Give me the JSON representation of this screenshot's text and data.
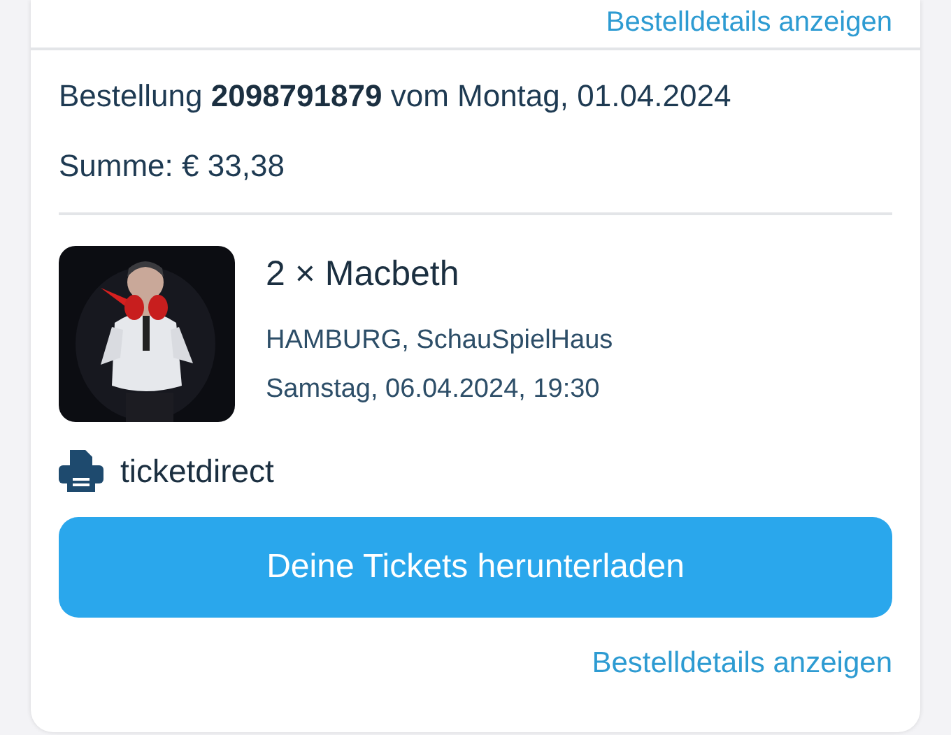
{
  "previous_order": {
    "details_link": "Bestelldetails anzeigen"
  },
  "order": {
    "heading": "Bestellung **2098791879** vom Montag, 01.04.2024",
    "total": "Summe: € 33,38",
    "items": [
      {
        "title": "2 × Macbeth",
        "venue": "HAMBURG, SchauSpielHaus",
        "datetime": "Samstag, 06.04.2024, 19:30"
      }
    ],
    "delivery": "ticketdirect",
    "download_button": "Deine Tickets herunterladen",
    "details_link": "Bestelldetails anzeigen"
  }
}
